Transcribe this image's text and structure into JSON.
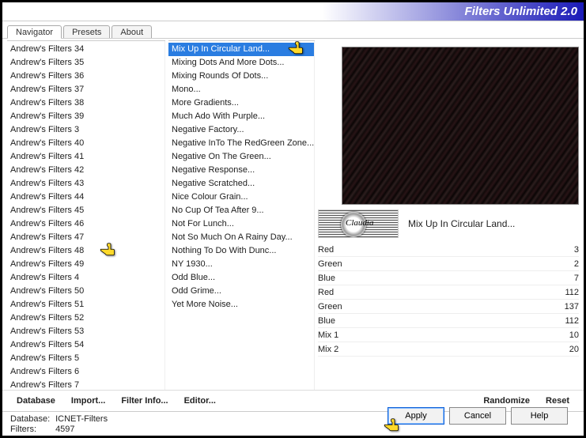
{
  "title": "Filters Unlimited 2.0",
  "tabs": [
    "Navigator",
    "Presets",
    "About"
  ],
  "active_tab": 0,
  "categories": [
    "Andrew's Filters 34",
    "Andrew's Filters 35",
    "Andrew's Filters 36",
    "Andrew's Filters 37",
    "Andrew's Filters 38",
    "Andrew's Filters 39",
    "Andrew's Filters 3",
    "Andrew's Filters 40",
    "Andrew's Filters 41",
    "Andrew's Filters 42",
    "Andrew's Filters 43",
    "Andrew's Filters 44",
    "Andrew's Filters 45",
    "Andrew's Filters 46",
    "Andrew's Filters 47",
    "Andrew's Filters 48",
    "Andrew's Filters 49",
    "Andrew's Filters 4",
    "Andrew's Filters 50",
    "Andrew's Filters 51",
    "Andrew's Filters 52",
    "Andrew's Filters 53",
    "Andrew's Filters 54",
    "Andrew's Filters 5",
    "Andrew's Filters 6",
    "Andrew's Filters 7"
  ],
  "selected_category_index": 15,
  "filters": [
    "Mix Up In Circular Land...",
    "Mixing Dots And More Dots...",
    "Mixing Rounds Of Dots...",
    "Mono...",
    "More Gradients...",
    "Much Ado With Purple...",
    "Negative Factory...",
    "Negative InTo The RedGreen Zone...",
    "Negative On The Green...",
    "Negative Response...",
    "Negative Scratched...",
    "Nice Colour Grain...",
    "No Cup Of Tea After 9...",
    "Not For Lunch...",
    "Not So Much On A Rainy Day...",
    "Nothing To Do With Dunc...",
    "NY 1930...",
    "Odd Blue...",
    "Odd Grime...",
    "Yet More Noise..."
  ],
  "selected_filter_index": 0,
  "current_filter_title": "Mix Up In Circular Land...",
  "logo_text": "Claudia",
  "sliders": [
    {
      "label": "Red",
      "value": 3
    },
    {
      "label": "Green",
      "value": 2
    },
    {
      "label": "Blue",
      "value": 7
    },
    {
      "label": "Red",
      "value": 112
    },
    {
      "label": "Green",
      "value": 137
    },
    {
      "label": "Blue",
      "value": 112
    },
    {
      "label": "Mix 1",
      "value": 10
    },
    {
      "label": "Mix 2",
      "value": 20
    }
  ],
  "toolbar": {
    "database": "Database",
    "import": "Import...",
    "filter_info": "Filter Info...",
    "editor": "Editor...",
    "randomize": "Randomize",
    "reset": "Reset"
  },
  "status": {
    "database_label": "Database:",
    "database_value": "ICNET-Filters",
    "filters_label": "Filters:",
    "filters_value": "4597"
  },
  "buttons": {
    "apply": "Apply",
    "cancel": "Cancel",
    "help": "Help"
  }
}
